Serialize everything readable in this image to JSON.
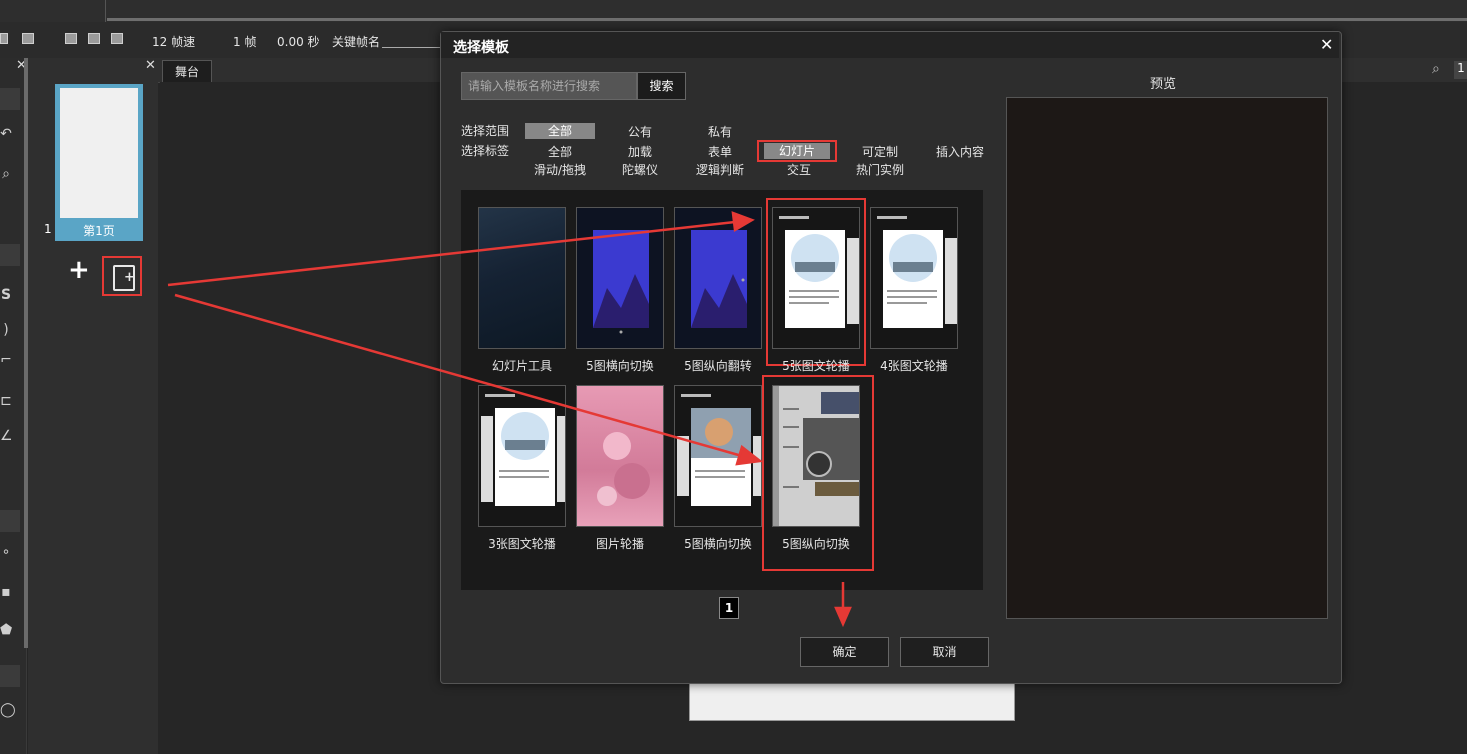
{
  "toolbar": {
    "fps": "12 帧速",
    "frame": "1 帧",
    "seconds": "0.00 秒",
    "keyframe_label": "关键帧名"
  },
  "pages": {
    "thumb_number": "1",
    "thumb_label": "第1页",
    "add_glyph": "+"
  },
  "stage": {
    "tab": "舞台",
    "zoom": "1"
  },
  "dialog": {
    "title": "选择模板",
    "close": "✕",
    "search_placeholder": "请输入模板名称进行搜索",
    "search_button": "搜索",
    "scope_label": "选择范围",
    "scope_options": [
      "全部",
      "公有",
      "私有"
    ],
    "tag_label": "选择标签",
    "tags_row1": [
      "全部",
      "加载",
      "表单",
      "幻灯片",
      "可定制",
      "插入内容"
    ],
    "tags_row2": [
      "滑动/拖拽",
      "陀螺仪",
      "逻辑判断",
      "交互",
      "热门实例"
    ],
    "templates": [
      {
        "label": "幻灯片工具"
      },
      {
        "label": "5图横向切换"
      },
      {
        "label": "5图纵向翻转"
      },
      {
        "label": "5张图文轮播"
      },
      {
        "label": "4张图文轮播"
      },
      {
        "label": "3张图文轮播"
      },
      {
        "label": "图片轮播"
      },
      {
        "label": "5图横向切换"
      },
      {
        "label": "5图纵向切换"
      }
    ],
    "page_number": "1",
    "ok": "确定",
    "cancel": "取消",
    "preview_title": "预览"
  },
  "colors": {
    "highlight": "#e53935",
    "thumb_accent": "#5aa5c6"
  }
}
